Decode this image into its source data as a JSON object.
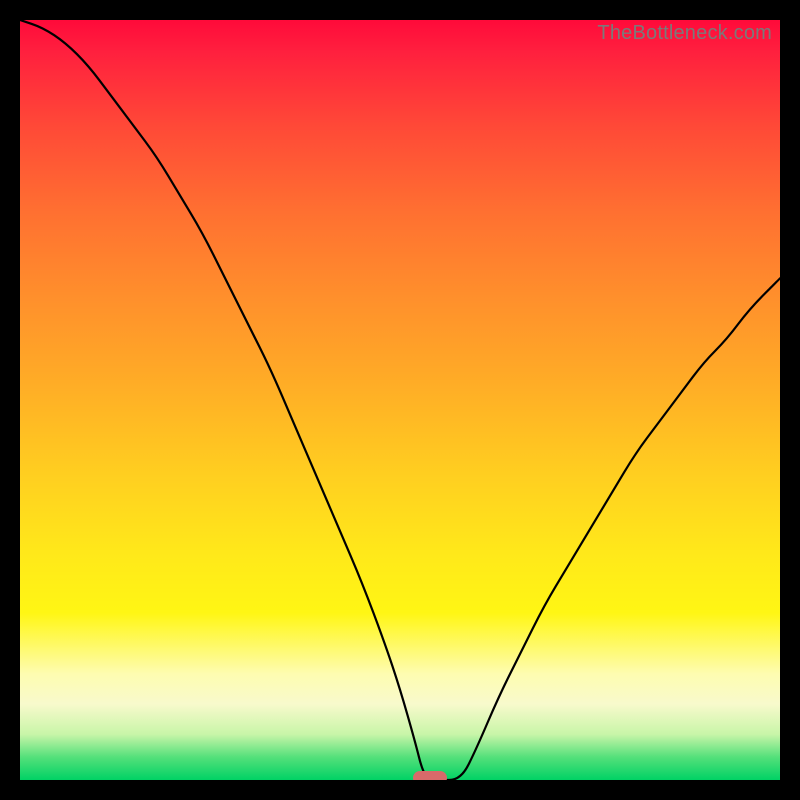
{
  "watermark": "TheBottleneck.com",
  "marker": {
    "color": "#d86a6a"
  },
  "chart_data": {
    "type": "line",
    "title": "",
    "xlabel": "",
    "ylabel": "",
    "xlim": [
      0,
      100
    ],
    "ylim": [
      0,
      100
    ],
    "grid": false,
    "legend": false,
    "x": [
      0,
      3,
      6,
      9,
      12,
      15,
      18,
      21,
      24,
      27,
      30,
      33,
      36,
      39,
      42,
      45,
      48,
      50,
      52,
      53,
      54,
      55,
      58,
      60,
      63,
      66,
      69,
      72,
      75,
      78,
      81,
      84,
      87,
      90,
      93,
      96,
      100
    ],
    "values": [
      100,
      99,
      97,
      94,
      90,
      86,
      82,
      77,
      72,
      66,
      60,
      54,
      47,
      40,
      33,
      26,
      18,
      12,
      5,
      1,
      0,
      0,
      0,
      4,
      11,
      17,
      23,
      28,
      33,
      38,
      43,
      47,
      51,
      55,
      58,
      62,
      66
    ],
    "annotations": [
      {
        "type": "marker",
        "shape": "oval",
        "x": 54,
        "y": 0,
        "color": "#d86a6a"
      }
    ],
    "notes": "Single black V-shaped curve over a vertical rainbow gradient (red top → green bottom). Left branch starts at top-left and reaches a flat bottom near x≈52–58; right branch rises to about y≈66 at x=100. Values are approximate readings from pixel positions; there are no axes, ticks, or labels visible."
  }
}
